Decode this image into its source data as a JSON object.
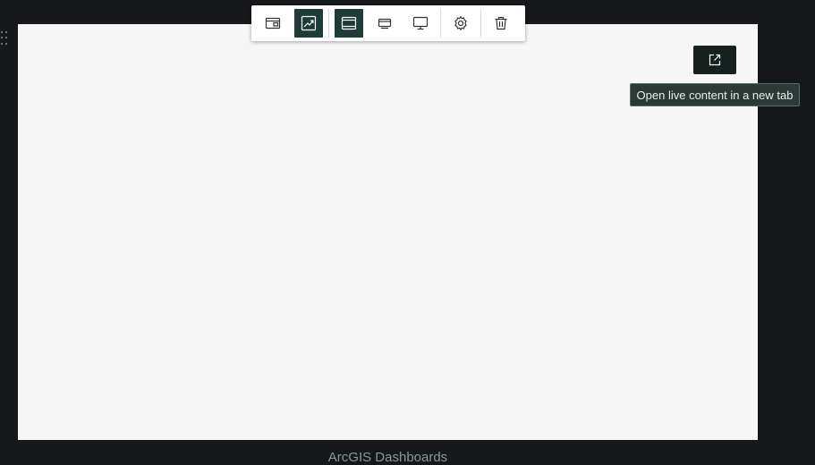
{
  "toolbar": {
    "buttons": [
      {
        "icon": "layout-card-icon",
        "active": false
      },
      {
        "icon": "chart-image-icon",
        "active": true
      },
      {
        "icon": "display-wide-icon",
        "active": true
      },
      {
        "icon": "display-tablet-icon",
        "active": false
      },
      {
        "icon": "display-monitor-icon",
        "active": false
      },
      {
        "icon": "settings-gear-icon",
        "active": false
      },
      {
        "icon": "trash-icon",
        "active": false
      }
    ],
    "active_color": "#1f3b37"
  },
  "open_button": {
    "icon": "external-link-icon"
  },
  "tooltip": {
    "text": "Open live content in a new tab"
  },
  "footer": {
    "text": "ArcGIS Dashboards"
  },
  "colors": {
    "background": "#16181c",
    "frame": "#f6f6f6",
    "footer_text": "#7f9ca1"
  }
}
